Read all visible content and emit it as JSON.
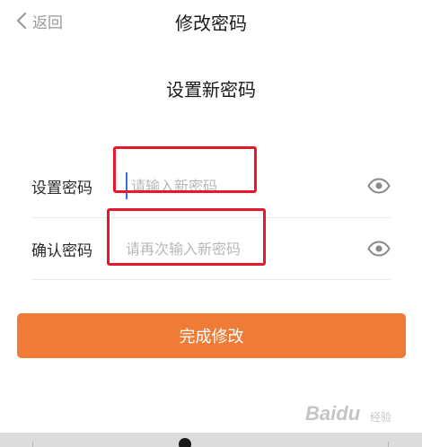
{
  "nav": {
    "back_label": "返回",
    "title": "修改密码"
  },
  "section": {
    "heading": "设置新密码"
  },
  "form": {
    "new_password": {
      "label": "设置密码",
      "placeholder": "请输入新密码",
      "value": ""
    },
    "confirm_password": {
      "label": "确认密码",
      "placeholder": "请再次输入新密码",
      "value": ""
    }
  },
  "submit": {
    "label": "完成修改"
  },
  "watermark": {
    "text": "Bai",
    "paw": "du",
    "sub": "经验"
  },
  "colors": {
    "accent": "#ee7b36",
    "annotation": "#e8182a",
    "cursor": "#3a6de8"
  },
  "icons": {
    "back": "chevron-left-icon",
    "toggle_visibility": "eye-icon"
  }
}
